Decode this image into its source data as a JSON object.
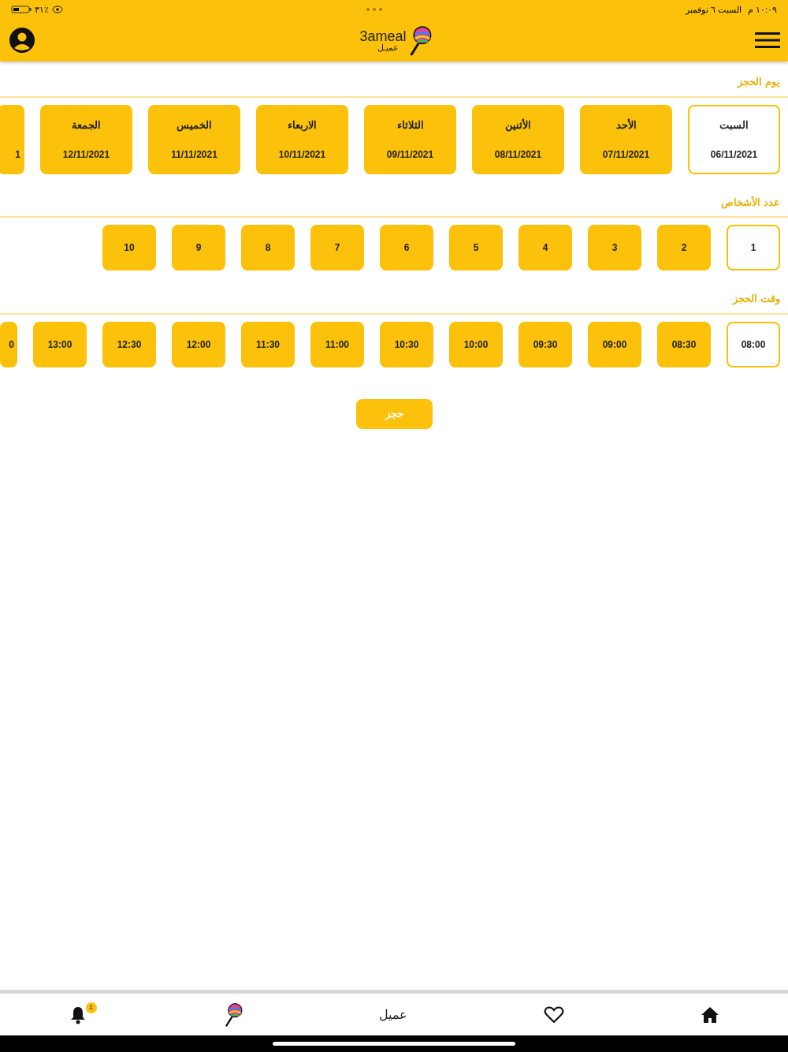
{
  "status_bar": {
    "time": "١٠:٠٩ م",
    "date": "السبت ٦ نوفمبر",
    "battery": "٣١٪"
  },
  "header": {
    "logo_latin": "3ameal",
    "logo_arabic": "عميـل"
  },
  "day_section": {
    "label": "يوم الحجز",
    "days": [
      {
        "kind": "full",
        "day": "السبت",
        "date": "06/11/2021",
        "selected": true
      },
      {
        "kind": "full",
        "day": "الأحد",
        "date": "07/11/2021",
        "selected": false
      },
      {
        "kind": "full",
        "day": "الأثنين",
        "date": "08/11/2021",
        "selected": false
      },
      {
        "kind": "full",
        "day": "الثلاثاء",
        "date": "09/11/2021",
        "selected": false
      },
      {
        "kind": "full",
        "day": "الاربعاء",
        "date": "10/11/2021",
        "selected": false
      },
      {
        "kind": "full",
        "day": "الخميس",
        "date": "11/11/2021",
        "selected": false
      },
      {
        "kind": "full",
        "day": "الجمعة",
        "date": "12/11/2021",
        "selected": false
      },
      {
        "kind": "partial",
        "date": "1",
        "selected": false
      }
    ]
  },
  "people_section": {
    "label": "عدد الأشخاص",
    "options": [
      {
        "label": "1",
        "selected": true
      },
      {
        "label": "2",
        "selected": false
      },
      {
        "label": "3",
        "selected": false
      },
      {
        "label": "4",
        "selected": false
      },
      {
        "label": "5",
        "selected": false
      },
      {
        "label": "6",
        "selected": false
      },
      {
        "label": "7",
        "selected": false
      },
      {
        "label": "8",
        "selected": false
      },
      {
        "label": "9",
        "selected": false
      },
      {
        "label": "10",
        "selected": false
      }
    ]
  },
  "time_section": {
    "label": "وقت الحجز",
    "options": [
      {
        "kind": "full",
        "label": "08:00",
        "selected": true
      },
      {
        "kind": "full",
        "label": "08:30",
        "selected": false
      },
      {
        "kind": "full",
        "label": "09:00",
        "selected": false
      },
      {
        "kind": "full",
        "label": "09:30",
        "selected": false
      },
      {
        "kind": "full",
        "label": "10:00",
        "selected": false
      },
      {
        "kind": "full",
        "label": "10:30",
        "selected": false
      },
      {
        "kind": "full",
        "label": "11:00",
        "selected": false
      },
      {
        "kind": "full",
        "label": "11:30",
        "selected": false
      },
      {
        "kind": "full",
        "label": "12:00",
        "selected": false
      },
      {
        "kind": "full",
        "label": "12:30",
        "selected": false
      },
      {
        "kind": "full",
        "label": "13:00",
        "selected": false
      },
      {
        "kind": "partial",
        "label": "0",
        "selected": false
      }
    ]
  },
  "book_button": "حجز",
  "bottom_nav": {
    "notification_badge": "1",
    "center_label": "عميل"
  }
}
